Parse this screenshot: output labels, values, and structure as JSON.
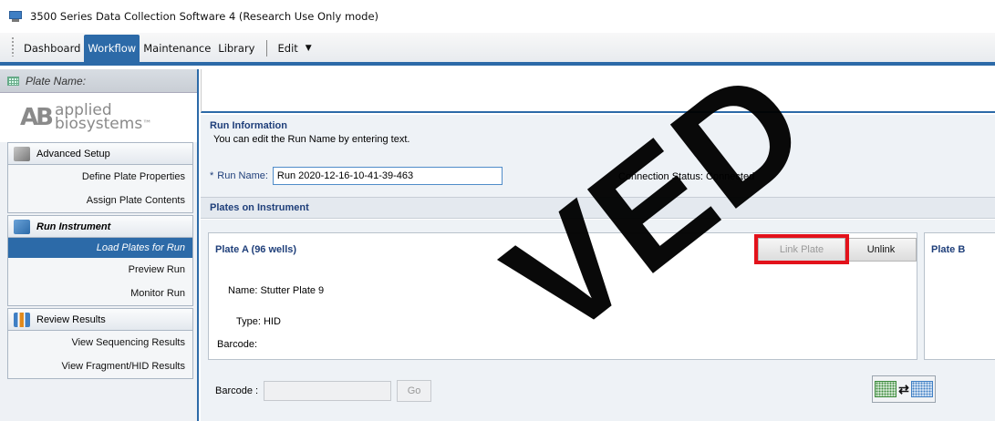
{
  "window": {
    "title": "3500 Series Data Collection Software 4 (Research Use Only mode)"
  },
  "menubar": {
    "tabs": [
      {
        "label": "Dashboard"
      },
      {
        "label": "Workflow"
      },
      {
        "label": "Maintenance"
      },
      {
        "label": "Library"
      }
    ],
    "edit_label": "Edit",
    "edit_caret": "▼"
  },
  "sidebar": {
    "plate_name_label": "Plate Name:",
    "logo": {
      "mark": "AB",
      "line1": "applied",
      "line2": "biosystems",
      "tm": "™"
    },
    "sections": [
      {
        "header": "Advanced Setup",
        "items": [
          "Define Plate Properties",
          "Assign Plate Contents"
        ]
      },
      {
        "header": "Run Instrument",
        "items": [
          "Load Plates for Run",
          "Preview Run",
          "Monitor Run"
        ],
        "selected_item": "Load Plates for Run"
      },
      {
        "header": "Review Results",
        "items": [
          "View Sequencing Results",
          "View Fragment/HID Results"
        ]
      }
    ]
  },
  "run_info": {
    "title": "Run Information",
    "description": "You can edit the Run Name by entering text.",
    "asterisk": "*",
    "run_name_label": "Run Name:",
    "run_name_value": "Run 2020-12-16-10-41-39-463",
    "connection_status": "Connection Status: Connected"
  },
  "plates": {
    "section_title": "Plates on Instrument",
    "plate_a": {
      "title": "Plate A (96 wells)",
      "link_button": "Link Plate",
      "unlink_button": "Unlink",
      "name": "Name:  Stutter Plate 9",
      "type": "Type:  HID",
      "barcode": "Barcode:"
    },
    "plate_b": {
      "title": "Plate B"
    },
    "barcode_label": "Barcode :",
    "go_button": "Go",
    "swap_arrows": "⇄"
  },
  "watermark": "VED",
  "colors": {
    "accent": "#2c6aa8",
    "highlight": "#e3121b",
    "section_title": "#1f3f7a"
  }
}
